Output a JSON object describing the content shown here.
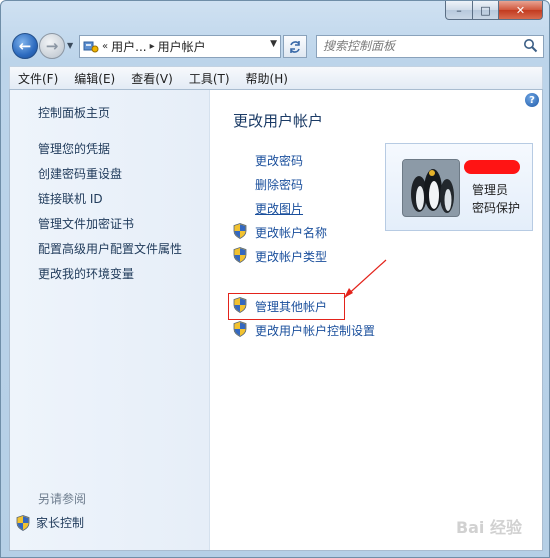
{
  "window": {
    "caption_min": "–",
    "caption_max": "□",
    "caption_close": "✕"
  },
  "address_bar": {
    "overflow": "«",
    "crumbs": [
      "用户...",
      "用户帐户"
    ],
    "separator": "▸"
  },
  "search": {
    "placeholder": "搜索控制面板"
  },
  "menu": [
    "文件(F)",
    "编辑(E)",
    "查看(V)",
    "工具(T)",
    "帮助(H)"
  ],
  "sidebar": {
    "home": "控制面板主页",
    "links": [
      "管理您的凭据",
      "创建密码重设盘",
      "链接联机 ID",
      "管理文件加密证书",
      "配置高级用户配置文件属性",
      "更改我的环境变量"
    ],
    "see_also": "另请参阅",
    "family_safety": "家长控制"
  },
  "main": {
    "title": "更改用户帐户",
    "tasks": [
      "更改密码",
      "删除密码",
      "更改图片"
    ],
    "shield_tasks": [
      "更改帐户名称",
      "更改帐户类型"
    ],
    "manage_other": "管理其他帐户",
    "uac_settings": "更改用户帐户控制设置"
  },
  "user_card": {
    "role": "管理员",
    "status": "密码保护"
  },
  "watermark": "Bai 经验",
  "colors": {
    "link": "#1a4f9c",
    "highlight": "#e3231b",
    "title": "#1b3b66"
  }
}
